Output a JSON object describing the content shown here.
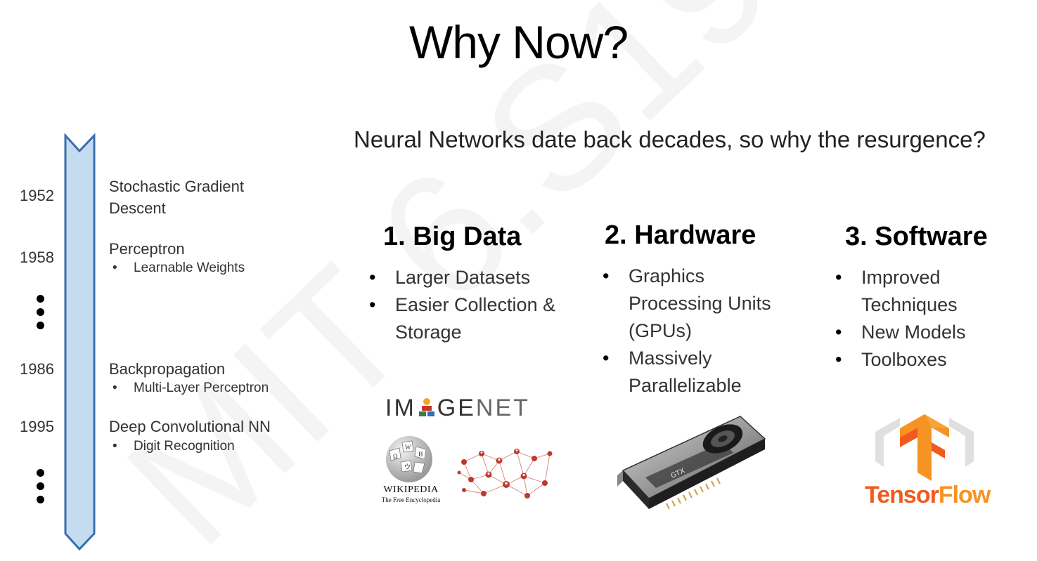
{
  "slide": {
    "title": "Why Now?",
    "subtitle": "Neural Networks date back decades, so why the resurgence?",
    "watermark": "MIT 6.S191"
  },
  "timeline": {
    "entries": [
      {
        "year": "1952",
        "event_line1": "Stochastic Gradient",
        "event_line2": "Descent"
      },
      {
        "year": "1958",
        "event": "Perceptron",
        "detail": "Learnable Weights"
      },
      {
        "year": "1986",
        "event": "Backpropagation",
        "detail": "Multi-Layer Perceptron"
      },
      {
        "year": "1995",
        "event": "Deep Convolutional NN",
        "detail": "Digit Recognition"
      }
    ]
  },
  "columns": [
    {
      "heading": "1. Big Data",
      "items": [
        "Larger Datasets",
        "Easier Collection & Storage"
      ]
    },
    {
      "heading": "2. Hardware",
      "items": [
        "Graphics Processing Units (GPUs)",
        "Massively Parallelizable"
      ]
    },
    {
      "heading": "3. Software",
      "items": [
        "Improved Techniques",
        "New Models",
        "Toolboxes"
      ]
    }
  ],
  "logos": {
    "imagenet_part1": "IM",
    "imagenet_part2": "GE",
    "imagenet_part3": "NET",
    "wikipedia_name": "WIKIPEDIA",
    "wikipedia_tagline": "The Free Encyclopedia",
    "tensorflow_part1": "Tensor",
    "tensorflow_part2": "Flow",
    "gpu_label": "GTX"
  },
  "colors": {
    "timeline_fill": "#c5dcf0",
    "timeline_stroke": "#3a6fae",
    "tensorflow_orange": "#f25a1d",
    "tensorflow_amber": "#f59323",
    "network_red": "#c0392b"
  }
}
